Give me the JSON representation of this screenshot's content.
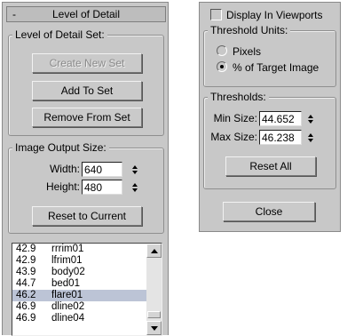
{
  "left_panel": {
    "rollout_title": "Level of Detail",
    "collapse_symbol": "-",
    "lod_set": {
      "label": "Level of Detail Set:",
      "create_label": "Create New Set",
      "add_label": "Add To Set",
      "remove_label": "Remove From Set"
    },
    "image_output": {
      "label": "Image Output Size:",
      "width_label": "Width:",
      "width_value": "640",
      "height_label": "Height:",
      "height_value": "480",
      "reset_label": "Reset to Current"
    },
    "list": {
      "items": [
        {
          "value": "42.9",
          "name": "rrrim01"
        },
        {
          "value": "42.9",
          "name": "lfrim01"
        },
        {
          "value": "43.9",
          "name": "body02"
        },
        {
          "value": "44.7",
          "name": "bed01"
        },
        {
          "value": "46.2",
          "name": "flare01"
        },
        {
          "value": "46.9",
          "name": "dline02"
        },
        {
          "value": "46.9",
          "name": "dline04"
        }
      ],
      "selected_index": 4
    }
  },
  "right_panel": {
    "display_in_viewports_label": "Display In Viewports",
    "display_in_viewports_checked": false,
    "threshold_units": {
      "label": "Threshold Units:",
      "pixels_label": "Pixels",
      "percent_label": "% of Target Image",
      "selected": "percent"
    },
    "thresholds": {
      "label": "Thresholds:",
      "min_label": "Min Size:",
      "min_value": "44.652",
      "max_label": "Max Size:",
      "max_value": "46.238",
      "reset_all_label": "Reset All"
    },
    "close_label": "Close"
  },
  "colors": {
    "panel_bg": "#c8c8c8",
    "selection": "#bcc4d6",
    "disabled_text": "#8b8b8b"
  }
}
